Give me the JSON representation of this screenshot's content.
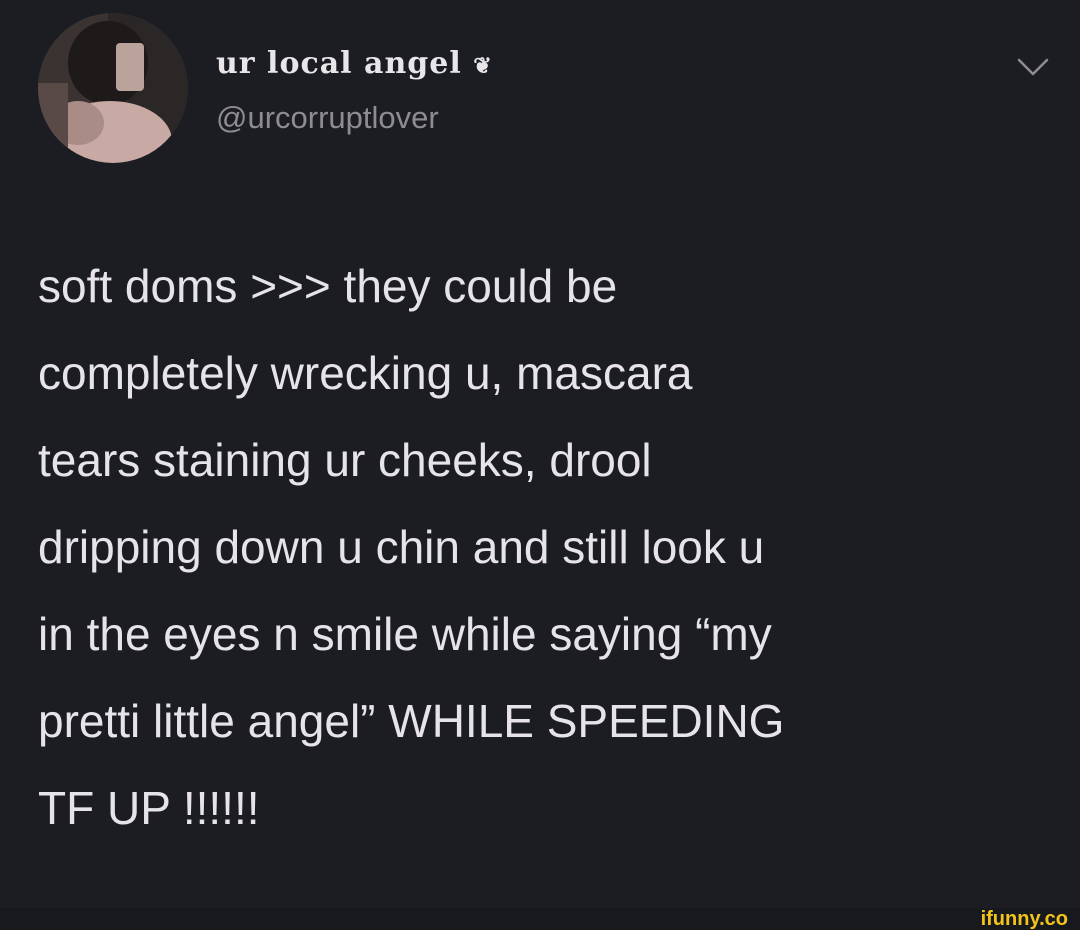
{
  "tweet": {
    "display_name": "ur local angel",
    "display_name_emoji": "❦",
    "handle": "@urcorruptlover",
    "more_icon": "chevron-down-icon",
    "body_lines": [
      "soft doms >>> they could be",
      "completely wrecking u, mascara",
      "tears staining ur cheeks, drool",
      "dripping down u chin and still look u",
      "in the eyes n smile while saying “my",
      "pretti little angel” WHILE SPEEDING",
      "TF UP !!!!!!"
    ]
  },
  "watermark": {
    "text": "ifunny.co",
    "color": "#f2c41b"
  }
}
